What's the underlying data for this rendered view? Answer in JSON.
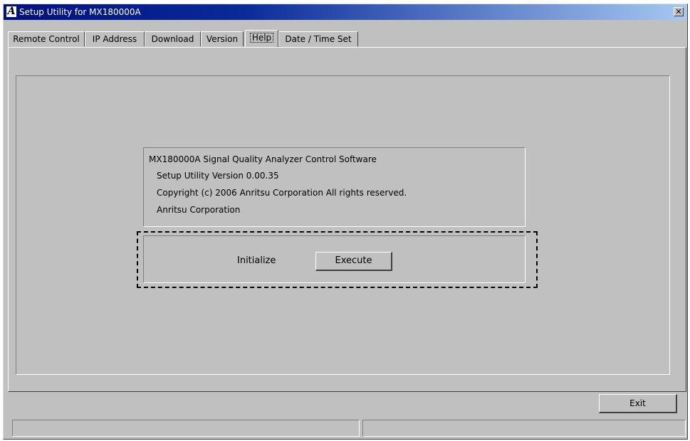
{
  "window": {
    "title": "Setup Utility for MX180000A",
    "logo_letter": "A",
    "close_glyph": "✕"
  },
  "tabs": [
    {
      "label": "Remote Control"
    },
    {
      "label": "IP Address"
    },
    {
      "label": "Download"
    },
    {
      "label": "Version"
    },
    {
      "label": "Help",
      "selected": true
    },
    {
      "label": "Date / Time Set"
    }
  ],
  "help": {
    "info_lines": [
      "MX180000A Signal Quality Analyzer Control Software",
      "Setup Utility Version 0.00.35",
      "Copyright (c) 2006 Anritsu Corporation  All rights reserved.",
      "Anritsu Corporation"
    ],
    "initialize_label": "Initialize",
    "execute_label": "Execute"
  },
  "footer": {
    "exit_label": "Exit",
    "status_left": "",
    "status_right": ""
  }
}
